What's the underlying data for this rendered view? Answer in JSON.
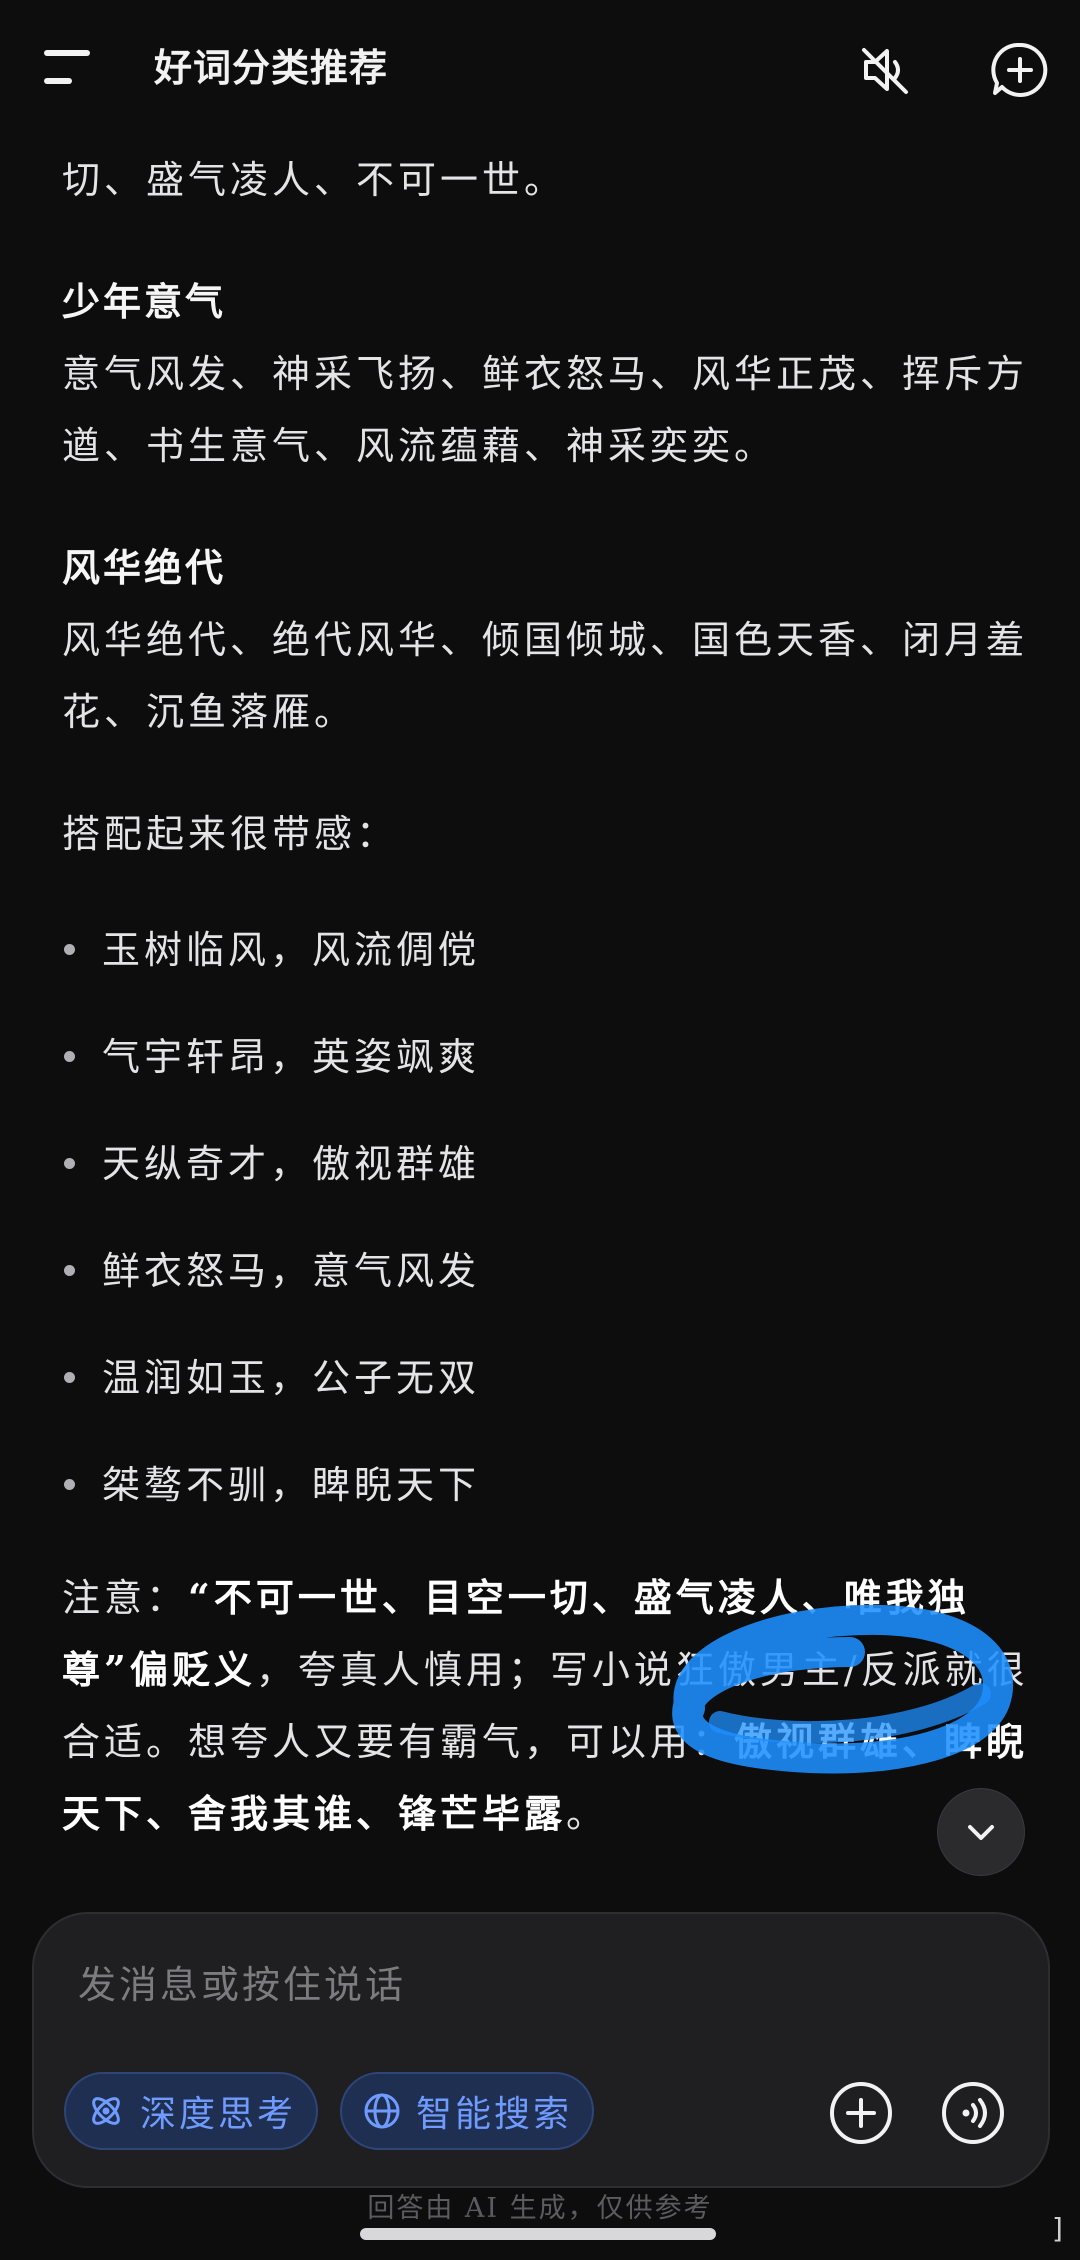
{
  "header": {
    "title": "好词分类推荐"
  },
  "content": {
    "partial_top_line": "切、盛气凌人、不可一世。",
    "section1": {
      "heading": "少年意气",
      "body": "意气风发、神采飞扬、鲜衣怒马、风华正茂、挥斥方遒、书生意气、风流蕴藉、神采奕奕。"
    },
    "section2": {
      "heading": "风华绝代",
      "body": "风华绝代、绝代风华、倾国倾城、国色天香、闭月羞花、沉鱼落雁。"
    },
    "combo_intro": "搭配起来很带感：",
    "combos": [
      "玉树临风，风流倜傥",
      "气宇轩昂，英姿飒爽",
      "天纵奇才，傲视群雄",
      "鲜衣怒马，意气风发",
      "温润如玉，公子无双",
      "桀骜不驯，睥睨天下"
    ],
    "note": {
      "label": "注意：",
      "bold1": "“不可一世、目空一切、盛气凌人、唯我独尊”偏贬义",
      "text1": "，夸真人慎用；写小说狂傲男主/反派就很合适。想夸人又要有霸气，可以用：",
      "bold2": "傲视群雄、睥睨天下、舍我其谁、锋芒毕露",
      "text2": "。"
    }
  },
  "composer": {
    "placeholder": "发消息或按住说话",
    "deep_think_label": "深度思考",
    "smart_search_label": "智能搜索"
  },
  "footer": {
    "disclaimer": "回答由 AI 生成，仅供参考"
  },
  "colors": {
    "background": "#0d0d0e",
    "chip_text": "#6f9bff",
    "chip_bg": "#1f2f52",
    "scribble": "#1e8fff"
  },
  "icons": [
    "menu-icon",
    "mute-icon",
    "new-chat-icon",
    "chevron-down-icon",
    "atom-icon",
    "globe-icon",
    "plus-icon",
    "voice-icon"
  ]
}
